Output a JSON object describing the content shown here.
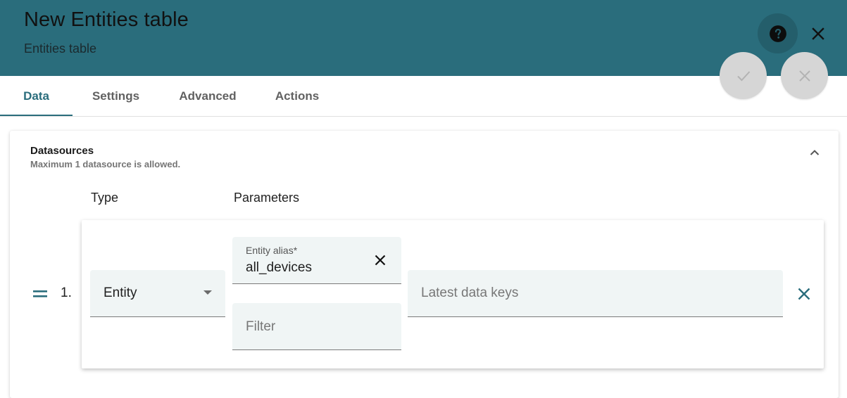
{
  "dialog": {
    "title": "New Entities table",
    "subtitle": "Entities table"
  },
  "header_actions": {
    "help_icon": "help-circle-icon",
    "close_icon": "close-icon",
    "apply_icon": "check-icon",
    "decline_icon": "close-icon"
  },
  "tabs": [
    {
      "label": "Data",
      "active": true
    },
    {
      "label": "Settings",
      "active": false
    },
    {
      "label": "Advanced",
      "active": false
    },
    {
      "label": "Actions",
      "active": false
    }
  ],
  "datasources": {
    "title": "Datasources",
    "hint": "Maximum 1 datasource is allowed.",
    "columns": {
      "type": "Type",
      "parameters": "Parameters"
    },
    "rows": [
      {
        "index": "1.",
        "type_value": "Entity",
        "alias_label": "Entity alias*",
        "alias_value": "all_devices",
        "filter_placeholder": "Filter",
        "keys_placeholder": "Latest data keys"
      }
    ]
  },
  "colors": {
    "primary": "#2a6d7c",
    "header_bg": "#2a6d7c",
    "field_bg": "#f0f5f5",
    "disabled_button": "#d6d6d6"
  }
}
